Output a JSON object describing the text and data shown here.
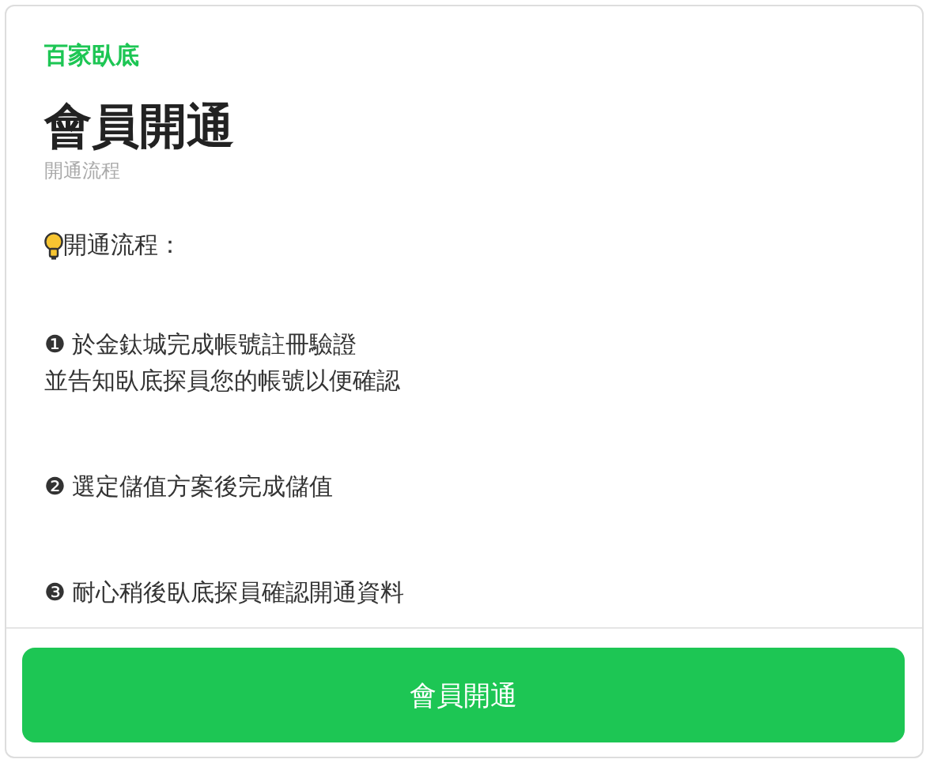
{
  "brand": "百家臥底",
  "title": "會員開通",
  "subtitle": "開通流程",
  "intro": "開通流程：",
  "steps": [
    {
      "lines": [
        "❶ 於金鈦城完成帳號註冊驗證",
        "並告知臥底探員您的帳號以便確認"
      ]
    },
    {
      "lines": [
        "❷ 選定儲值方案後完成儲值"
      ]
    },
    {
      "lines": [
        "❸ 耐心稍後臥底探員確認開通資料"
      ]
    }
  ],
  "button": "會員開通"
}
